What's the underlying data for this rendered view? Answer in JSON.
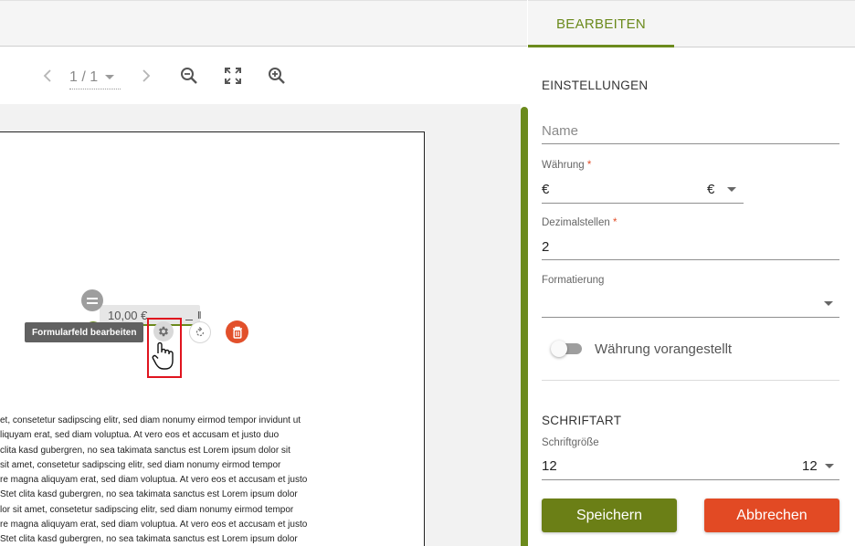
{
  "viewer": {
    "page_indicator": "1 / 1",
    "field": {
      "value": "10,00 €",
      "resize_glyph": "‖",
      "tooltip": "Formularfeld bearbeiten"
    },
    "lorem_lines": [
      "et, consetetur sadipscing elitr, sed diam nonumy eirmod tempor invidunt ut",
      "liquyam erat, sed diam voluptua. At vero eos et accusam et justo duo",
      "clita kasd gubergren, no sea takimata sanctus est Lorem ipsum dolor sit",
      "sit amet, consetetur sadipscing elitr, sed diam nonumy eirmod tempor",
      "re magna aliquyam erat, sed diam voluptua. At vero eos et accusam et justo",
      "Stet clita kasd gubergren, no sea takimata sanctus est Lorem ipsum dolor",
      "lor sit amet, consetetur sadipscing elitr, sed diam nonumy eirmod tempor",
      "re magna aliquyam erat, sed diam voluptua. At vero eos et accusam et justo",
      "Stet clita kasd gubergren, no sea takimata sanctus est Lorem ipsum dolor"
    ],
    "icons": [
      "chevron-left-icon",
      "chevron-right-icon",
      "zoom-out-icon",
      "fullscreen-icon",
      "zoom-in-icon",
      "drag-handle-icon",
      "gear-icon",
      "rotate-icon",
      "trash-icon",
      "hand-cursor-icon"
    ]
  },
  "panel": {
    "tab_label": "BEARBEITEN",
    "settings_title": "EINSTELLUNGEN",
    "name_placeholder": "Name",
    "currency": {
      "label": "Währung",
      "required_mark": "*",
      "value": "€",
      "selected": "€"
    },
    "decimals": {
      "label": "Dezimalstellen",
      "required_mark": "*",
      "value": "2"
    },
    "formatting": {
      "label": "Formatierung",
      "value": ""
    },
    "toggle": {
      "label": "Währung vorangestellt",
      "on": false
    },
    "font_title": "SCHRIFTART",
    "font_size": {
      "label": "Schriftgröße",
      "value": "12",
      "selected": "12"
    },
    "save_label": "Speichern",
    "cancel_label": "Abbrechen"
  },
  "colors": {
    "accent": "#6b8a1c",
    "danger": "#e24a24",
    "highlight": "#e0141e"
  }
}
